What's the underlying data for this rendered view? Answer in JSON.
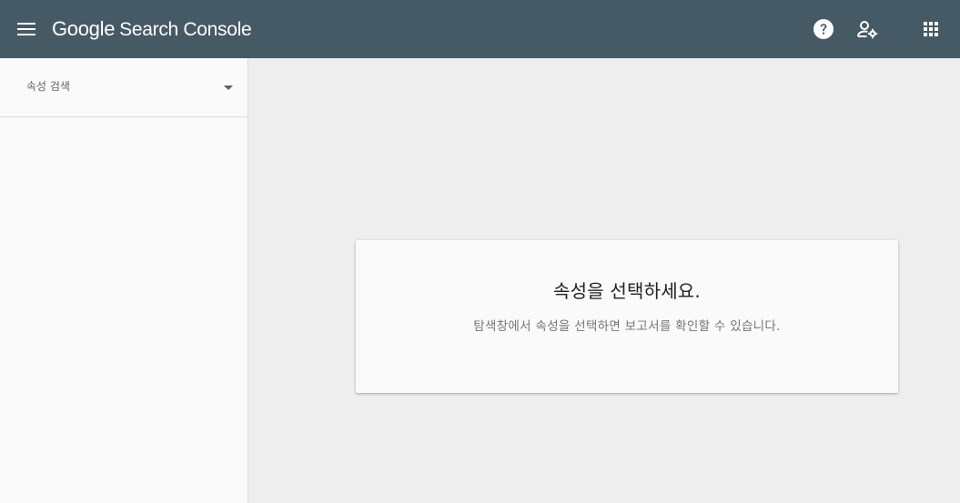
{
  "header": {
    "brand_google": "Google",
    "brand_product": "Search Console",
    "background_color": "#465a65",
    "icons": {
      "menu": "menu-icon",
      "help": "help-icon",
      "admin": "admin-settings-icon",
      "apps": "apps-grid-icon"
    }
  },
  "sidebar": {
    "property_search_label": "속성 검색"
  },
  "main": {
    "card": {
      "title": "속성을 선택하세요.",
      "description": "탐색창에서 속성을 선택하면 보고서를 확인할 수 있습니다."
    }
  }
}
